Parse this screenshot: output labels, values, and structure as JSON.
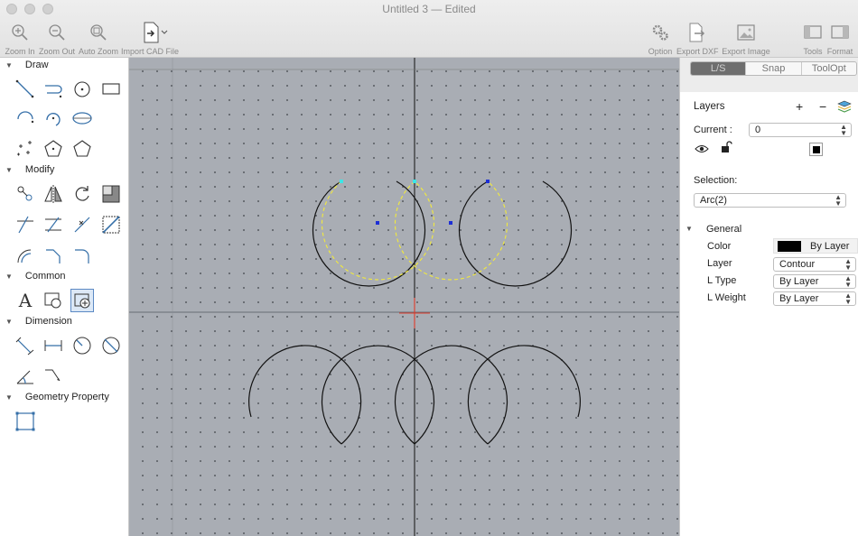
{
  "window": {
    "title": "Untitled 3 — Edited"
  },
  "toolbar": {
    "zoom_in": "Zoom In",
    "zoom_out": "Zoom Out",
    "auto_zoom": "Auto Zoom",
    "import_cad": "Import CAD File",
    "option": "Option",
    "export_dxf": "Export DXF",
    "export_image": "Export Image",
    "tools": "Tools",
    "format": "Format"
  },
  "palette": {
    "sections": {
      "draw": "Draw",
      "modify": "Modify",
      "common": "Common",
      "dimension": "Dimension",
      "geometry_property": "Geometry Property"
    },
    "text_tool_glyph": "A"
  },
  "inspector": {
    "tabs": [
      "L/S",
      "Snap",
      "ToolOpt"
    ],
    "active_tab": "L/S",
    "layers_title": "Layers",
    "add_symbol": "+",
    "remove_symbol": "−",
    "current_label": "Current :",
    "current_value": "0",
    "selection_label": "Selection:",
    "selection_value": "Arc(2)",
    "general_label": "General",
    "props": [
      {
        "label": "Color",
        "value": "By Layer"
      },
      {
        "label": "Layer",
        "value": "Contour"
      },
      {
        "label": "L Type",
        "value": "By Layer"
      },
      {
        "label": "L Weight",
        "value": "By Layer"
      }
    ]
  },
  "colors": {
    "canvas_bg": "#a9adb4",
    "selection_dash": "#f2ea3c",
    "cursor_cross": "#e03a2a",
    "active_tab_bg": "#6e6e6e"
  }
}
